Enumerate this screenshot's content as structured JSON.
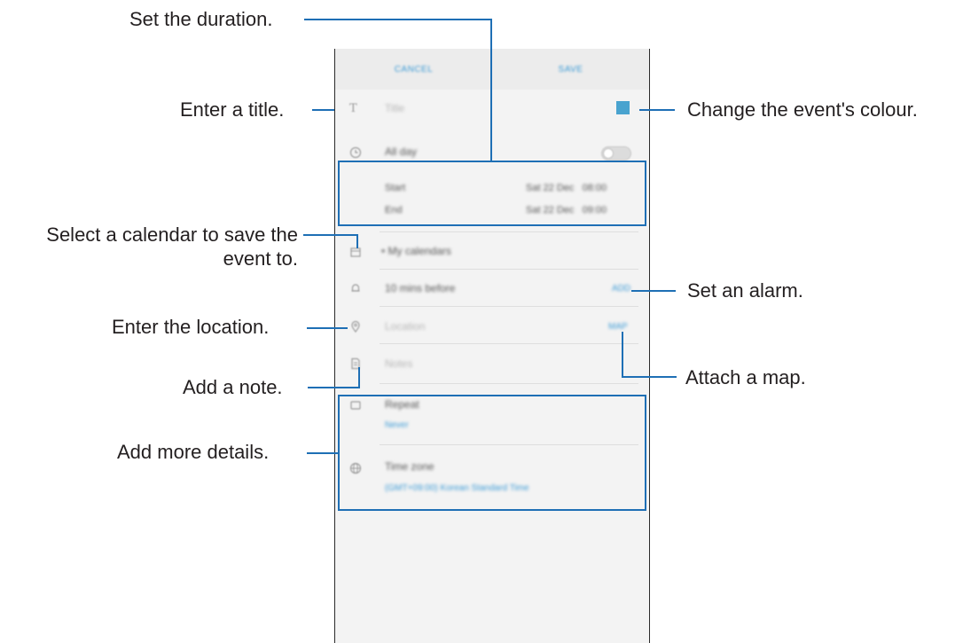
{
  "callouts": {
    "set_duration": "Set the duration.",
    "enter_title": "Enter a title.",
    "change_colour": "Change the event's colour.",
    "select_calendar_line1": "Select a calendar to save the",
    "select_calendar_line2": "event to.",
    "set_alarm": "Set an alarm.",
    "enter_location": "Enter the location.",
    "attach_map": "Attach a map.",
    "add_note": "Add a note.",
    "add_details": "Add more details."
  },
  "appbar": {
    "cancel": "CANCEL",
    "save": "SAVE"
  },
  "form": {
    "title_placeholder": "Title",
    "all_day": "All day",
    "start_label": "Start",
    "start_value": "Sat 22 Dec   08:00",
    "end_label": "End",
    "end_value": "Sat 22 Dec   09:00",
    "calendar": "• My calendars",
    "alarm": "10 mins before",
    "alarm_action": "ADD",
    "location_placeholder": "Location",
    "map_action": "MAP",
    "notes_placeholder": "Notes",
    "repeat_label": "Repeat",
    "repeat_value": "Never",
    "timezone_label": "Time zone",
    "timezone_value": "(GMT+09:00) Korean Standard Time"
  },
  "colors": {
    "accent": "#3a9ad6",
    "callout_line": "#1e6fb5",
    "event_colour": "#49a3cf"
  },
  "icons": [
    "title-icon",
    "clock-icon",
    "calendar-icon",
    "bell-icon",
    "location-pin-icon",
    "notes-icon",
    "repeat-icon",
    "globe-icon"
  ]
}
